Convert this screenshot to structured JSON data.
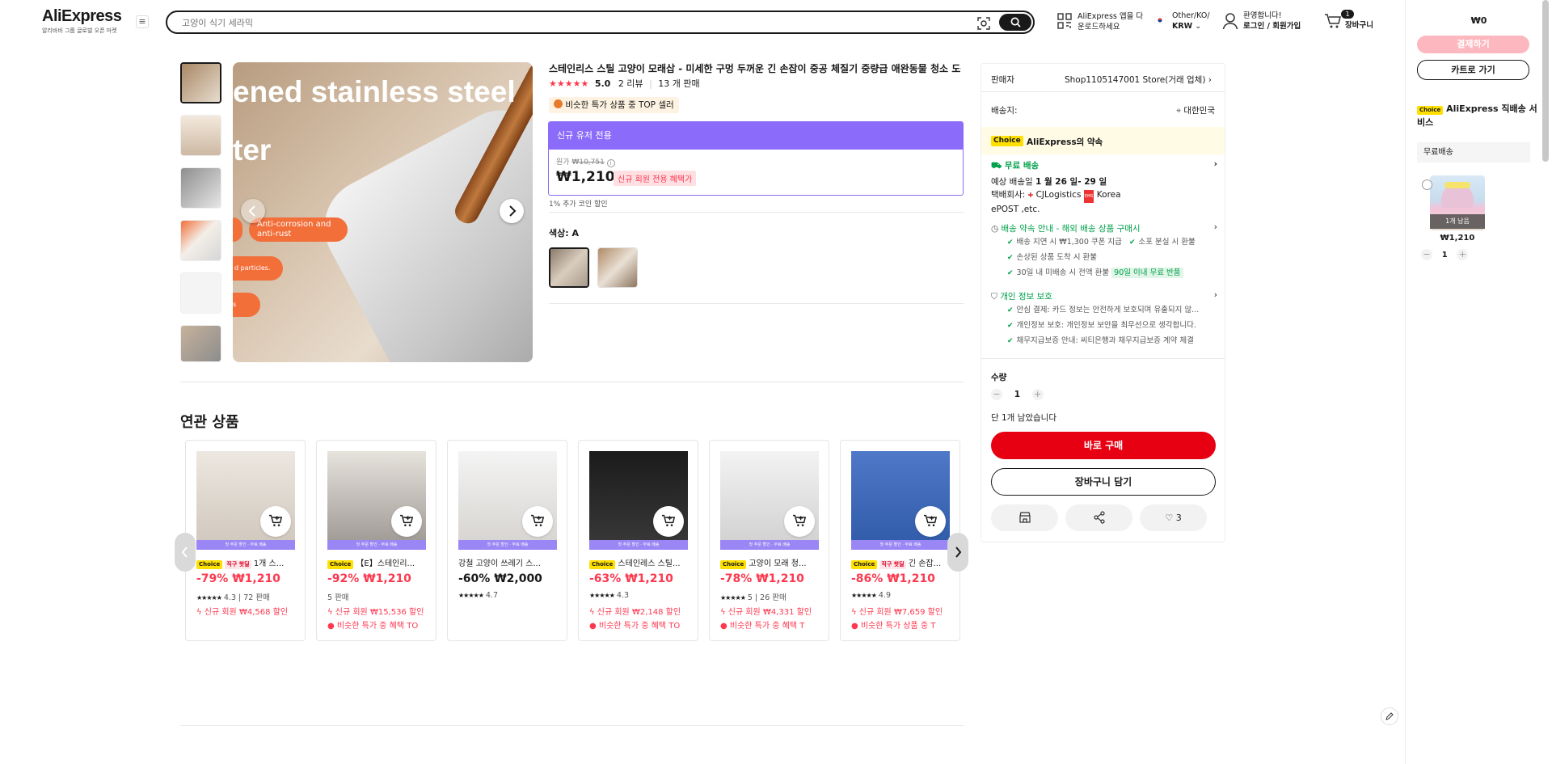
{
  "header": {
    "logo": "AliExpress",
    "logo_sub": "알리바바 그룹 글로벌 오픈 마켓",
    "search_placeholder": "고양이 식기 세라믹",
    "app_line1": "AliExpress 앱을 다",
    "app_line2": "운로드하세요",
    "region_line1": "Other/KO/",
    "region_line2": "KRW",
    "welcome": "환영합니다!",
    "login": "로그인 / 회원가입",
    "cart_count": "1",
    "cart_label": "장바구니"
  },
  "sidebar": {
    "total": "₩0",
    "pay_btn": "결제하기",
    "cart_btn": "카트로 가기",
    "choice": "Choice",
    "service": "AliExpress 직배송 서비스",
    "free": "무료배송",
    "stock": "1개 남음",
    "item_price": "₩1,210",
    "qty": "1",
    "minus": "−",
    "plus": "+"
  },
  "gallery": {
    "overlay1": "ened stainless steel",
    "overlay2": "ter",
    "pill1": "Anti-corrosion and anti-rust",
    "pill2": "d particles.",
    "pill3": "s"
  },
  "product": {
    "title": "스테인리스 스틸 고양이 모래삽 - 미세한 구멍 두꺼운 긴 손잡이 중공 체질기 중량급 애완동물 청소 도구",
    "stars": "★★★★★",
    "rating": "5.0",
    "reviews": "2 리뷰",
    "sold": "13 개 판매",
    "top_badge": "비슷한 특가 상품 중 TOP 셀러",
    "new_user_header": "신규 유저 전용",
    "orig_label": "원가",
    "orig_price": "₩10,751",
    "price": "₩1,210",
    "new_user_tag": "신규 회원 전용 혜택가",
    "coin_note": "1% 추가 코인 할인",
    "color_label": "색상: A"
  },
  "buybox": {
    "seller_label": "판매자",
    "seller_name": "Shop1105147001 Store(거래 업체)",
    "ship_to_label": "배송지:",
    "ship_to": "대한민국",
    "choice": "Choice",
    "promise": "AliExpress의 약속",
    "free_shipping": "무료 배송",
    "eta_prefix": "예상 배송일",
    "eta": "1 월 26 일- 29 일",
    "carrier_label": "택배회사:",
    "carrier1": "CJLogistics",
    "carrier2": "Korea",
    "carrier3": "ePOST ,etc.",
    "delivery_title": "배송 약속 안내 - 해외 배송 상품 구매시",
    "d1": "배송 지연 시 ₩1,300 쿠폰 지급",
    "d2": "소포 분실 시 환불",
    "d3": "손상된 상품 도착 시 환불",
    "d4": "30일 내 미배송 시 전액 환불",
    "d4_tag": "90일 이내 무료 반품",
    "privacy_title": "개인 정보 보호",
    "p1": "안심 결제: 카드 정보는 안전하게 보호되며 유출되지 않...",
    "p2": "개인정보 보호: 개인정보 보안을 최우선으로 생각합니다.",
    "p3": "채무지급보증 안내: 씨티은행과 채무지급보증 계약 체결",
    "qty_label": "수량",
    "qty": "1",
    "minus": "−",
    "plus": "+",
    "stock_note": "단 1개 남았습니다",
    "buy_now": "바로 구매",
    "add_cart": "장바구니 담기",
    "wish_count": "3"
  },
  "related": {
    "title": "연관 상품",
    "strip": "첫 주문 할인 · 무료 배송",
    "items": [
      {
        "choice": "Choice",
        "hot": "직구 핫딜",
        "name": "1개 스...",
        "price": "-79% ₩1,210",
        "rating": "4.3 | 72 판매",
        "l1": "신규 회원 ₩4,568 할인",
        "l2": ""
      },
      {
        "choice": "Choice",
        "hot": "",
        "name": "【E】스테인리...",
        "price": "-92% ₩1,210",
        "rating": "5 판매",
        "l1": "신규 회원 ₩15,536 할인",
        "l2": "비슷한 특가 중 혜택 TO"
      },
      {
        "choice": "",
        "hot": "",
        "name": "강철 고양이 쓰레기 스...",
        "price": "-60% ₩2,000",
        "rating": "4.7",
        "l1": "",
        "l2": ""
      },
      {
        "choice": "Choice",
        "hot": "",
        "name": "스테인레스 스틸...",
        "price": "-63% ₩1,210",
        "rating": "4.3",
        "l1": "신규 회원 ₩2,148 할인",
        "l2": "비슷한 특가 중 혜택 TO"
      },
      {
        "choice": "Choice",
        "hot": "",
        "name": "고양이 모래 청...",
        "price": "-78% ₩1,210",
        "rating": "5 | 26 판매",
        "l1": "신규 회원 ₩4,331 할인",
        "l2": "비슷한 특가 중 혜택 T"
      },
      {
        "choice": "Choice",
        "hot": "직구 핫딜",
        "name": "긴 손잡...",
        "price": "-86% ₩1,210",
        "rating": "4.9",
        "l1": "신규 회원 ₩7,659 할인",
        "l2": "비슷한 특가 상품 중 T"
      }
    ]
  }
}
